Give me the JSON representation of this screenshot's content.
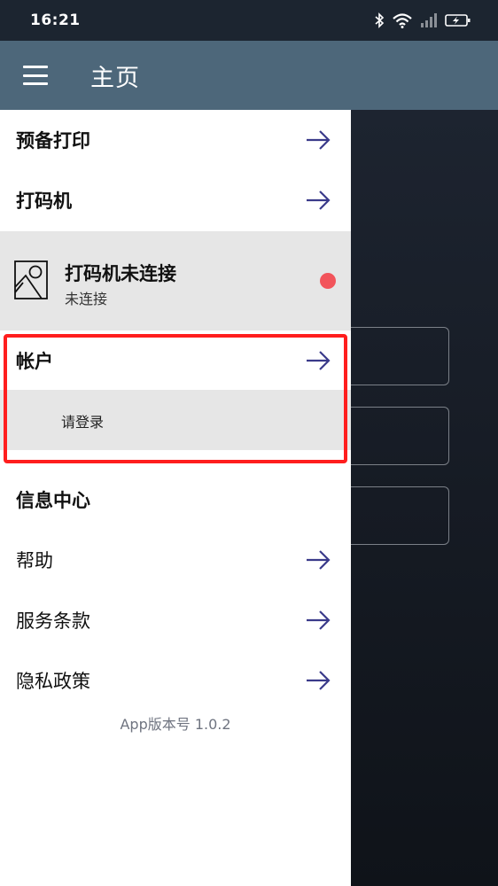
{
  "status_bar": {
    "time": "16:21",
    "icons": [
      "bluetooth-icon",
      "wifi-icon",
      "signal-icon",
      "battery-charging-icon"
    ]
  },
  "app_bar": {
    "menu_icon": "hamburger-menu-icon",
    "title": "主页"
  },
  "drawer": {
    "items_top": [
      {
        "label": "预备打印",
        "icon": "arrow-right-icon"
      },
      {
        "label": "打码机",
        "icon": "arrow-right-icon"
      }
    ],
    "printer": {
      "icon": "image-placeholder-icon",
      "title": "打码机未连接",
      "subtitle": "未连接",
      "status_color": "#f2545b"
    },
    "account": {
      "label": "帐户",
      "icon": "arrow-right-icon",
      "login_text": "请登录"
    },
    "info_center": {
      "label": "信息中心"
    },
    "items_bottom": [
      {
        "label": "帮助",
        "icon": "arrow-right-icon"
      },
      {
        "label": "服务条款",
        "icon": "arrow-right-icon"
      },
      {
        "label": "隐私政策",
        "icon": "arrow-right-icon"
      }
    ],
    "version": "App版本号 1.0.2"
  },
  "colors": {
    "status_bar": "#1c2530",
    "app_bar": "#4d677a",
    "arrow": "#3a3a8a",
    "highlight_border": "#ff1e1e"
  }
}
